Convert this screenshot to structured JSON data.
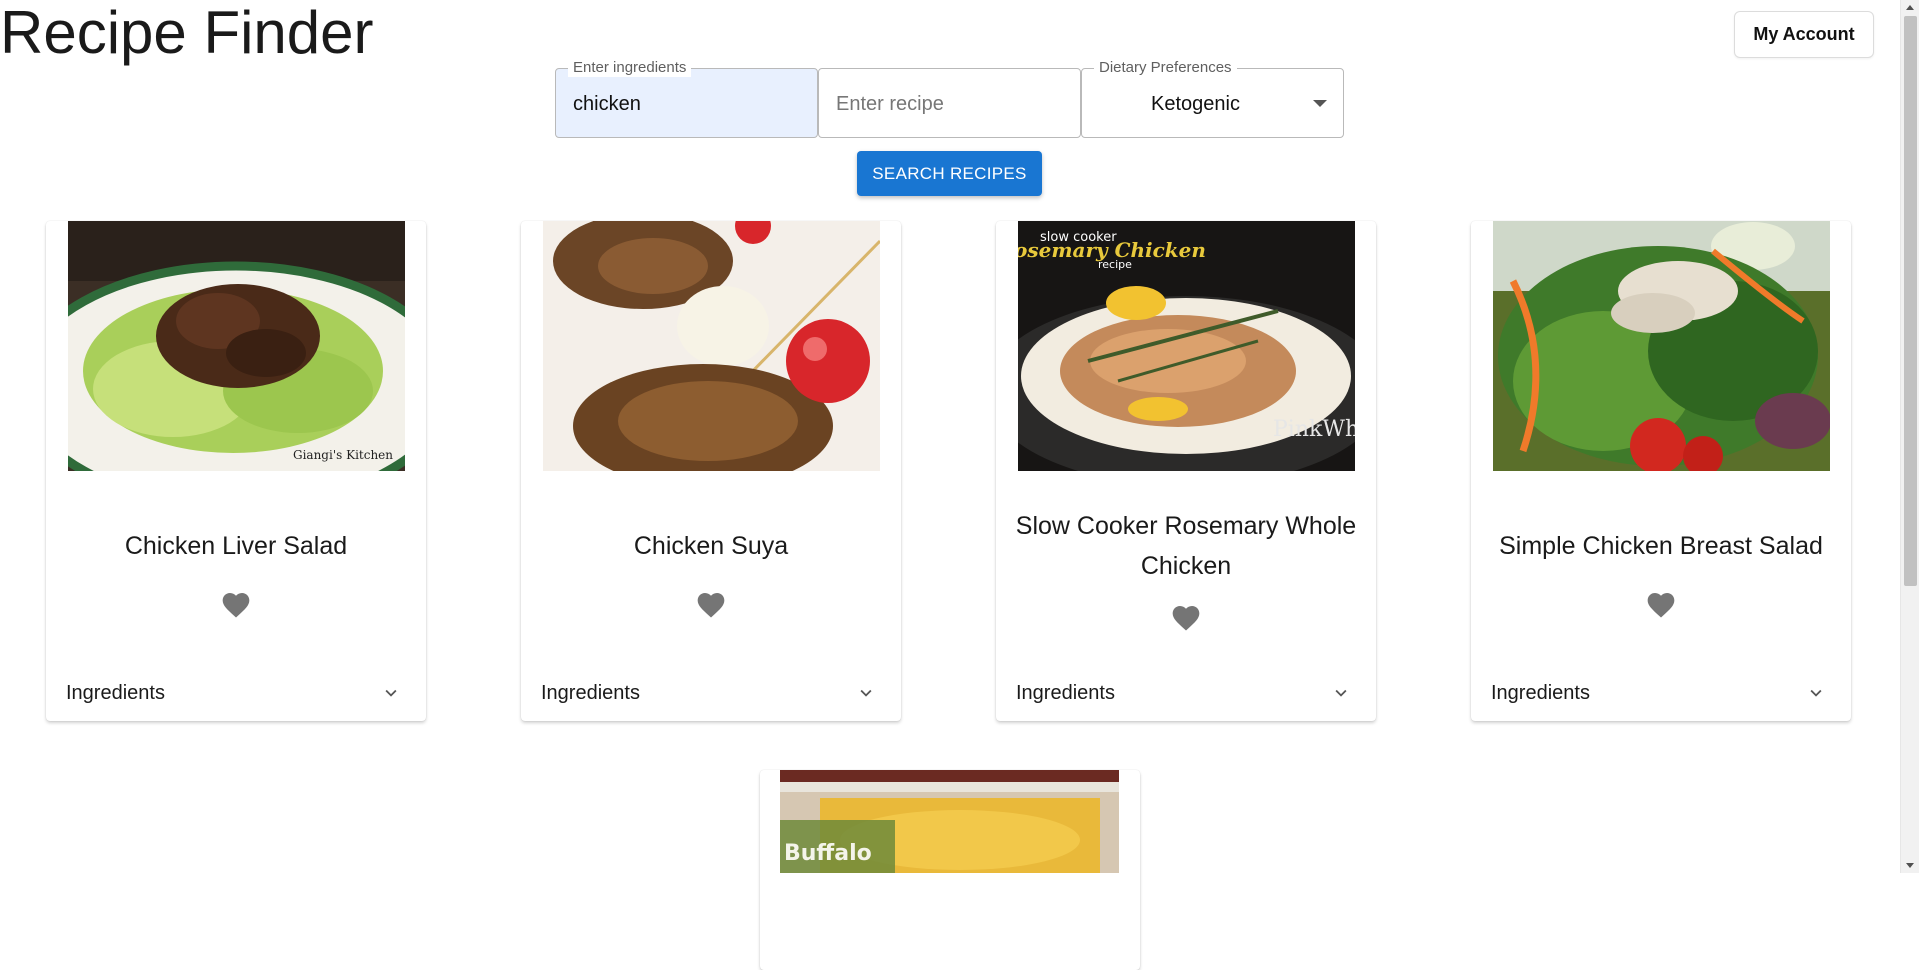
{
  "app_title": "Recipe Finder",
  "account_button": "My Account",
  "search": {
    "ingredients_label": "Enter ingredients",
    "ingredients_value": "chicken",
    "recipe_placeholder": "Enter recipe",
    "diet_label": "Dietary Preferences",
    "diet_value": "Ketogenic",
    "button_label": "SEARCH RECIPES"
  },
  "cards": [
    {
      "title": "Chicken Liver Salad",
      "ingredients_label": "Ingredients",
      "image_watermark": "Giangi's Kitchen"
    },
    {
      "title": "Chicken Suya",
      "ingredients_label": "Ingredients"
    },
    {
      "title": "Slow Cooker Rosemary Whole Chicken",
      "ingredients_label": "Ingredients",
      "image_caption_top": "slow cooker",
      "image_caption_main": "osemary Chicken",
      "image_caption_sub": "recipe",
      "image_watermark": "PinkWh"
    },
    {
      "title": "Simple Chicken Breast Salad",
      "ingredients_label": "Ingredients"
    },
    {
      "title": "",
      "image_caption_main": "Buffalo"
    }
  ],
  "colors": {
    "primary": "#1976d2",
    "field_autofill": "#e8f0fe",
    "icon": "#757575"
  },
  "icons": [
    "heart-icon",
    "chevron-down-icon",
    "dropdown-caret-icon"
  ]
}
